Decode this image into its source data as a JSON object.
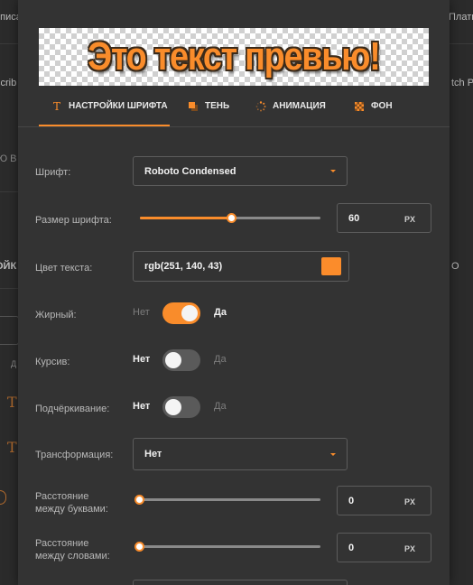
{
  "background": {
    "fragments": [
      "описан",
      "Платн",
      "scrib",
      "tch P",
      "Ю В",
      "ОЙК",
      "О",
      "Д"
    ]
  },
  "preview": {
    "text": "Это текст превью!"
  },
  "tabs": [
    {
      "label": "НАСТРОЙКИ ШРИФТА",
      "icon": "text-icon",
      "active": true
    },
    {
      "label": "ТЕНЬ",
      "icon": "shadow-icon",
      "active": false
    },
    {
      "label": "АНИМАЦИЯ",
      "icon": "spinner-icon",
      "active": false
    },
    {
      "label": "ФОН",
      "icon": "background-pattern-icon",
      "active": false
    }
  ],
  "settings": {
    "font": {
      "label": "Шрифт:",
      "value": "Roboto Condensed"
    },
    "font_size": {
      "label": "Размер шрифта:",
      "value": "60",
      "unit": "PX",
      "slider_fraction": 0.51
    },
    "text_color": {
      "label": "Цвет текста:",
      "value": "rgb(251, 140, 43)",
      "swatch": "#fb8c2b"
    },
    "bold": {
      "label": "Жирный:",
      "no": "Нет",
      "yes": "Да",
      "on": true
    },
    "italic": {
      "label": "Курсив:",
      "no": "Нет",
      "yes": "Да",
      "on": false
    },
    "underline": {
      "label": "Подчёркивание:",
      "no": "Нет",
      "yes": "Да",
      "on": false
    },
    "transform": {
      "label": "Трансформация:",
      "value": "Нет"
    },
    "letter_spacing": {
      "label_line1": "Расстояние",
      "label_line2": "между буквами:",
      "value": "0",
      "unit": "PX",
      "slider_fraction": 0
    },
    "word_spacing": {
      "label_line1": "Расстояние",
      "label_line2": "между словами:",
      "value": "0",
      "unit": "PX",
      "slider_fraction": 0
    }
  },
  "colors": {
    "accent": "#f98c2b",
    "switch_off": "#5a5a5a",
    "panel": "#333333"
  }
}
